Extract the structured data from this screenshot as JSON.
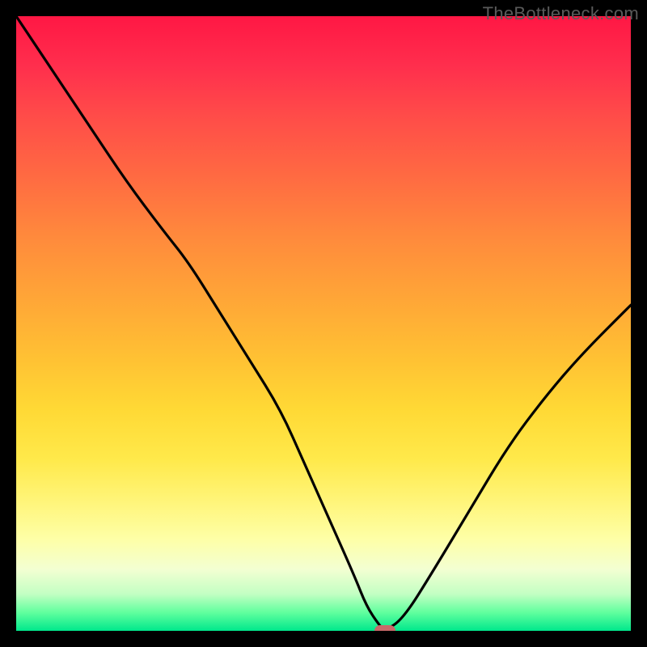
{
  "watermark": "TheBottleneck.com",
  "colors": {
    "page_bg": "#000000",
    "curve_stroke": "#000000",
    "marker_fill": "#c96a6a",
    "watermark_text": "#5a5a5a",
    "gradient_stops": [
      "#ff1744",
      "#ff2e4d",
      "#ff4b49",
      "#ff6a42",
      "#ff8a3c",
      "#ffa637",
      "#ffc233",
      "#ffd935",
      "#ffe94a",
      "#fff57a",
      "#feffa6",
      "#f3ffd2",
      "#c3ffc3",
      "#61ff9e",
      "#00e88c"
    ]
  },
  "chart_data": {
    "type": "line",
    "title": "",
    "xlabel": "",
    "ylabel": "",
    "xlim": [
      0,
      100
    ],
    "ylim": [
      0,
      100
    ],
    "grid": false,
    "legend": false,
    "background": "vertical rainbow gradient (green bottom → red top) indicating bottleneck severity",
    "series": [
      {
        "name": "bottleneck-curve",
        "x": [
          0,
          6,
          12,
          18,
          24,
          28,
          33,
          38,
          43,
          47,
          51,
          55,
          57,
          59,
          60,
          63,
          68,
          74,
          80,
          86,
          92,
          100
        ],
        "values": [
          100,
          91,
          82,
          73,
          65,
          60,
          52,
          44,
          36,
          27,
          18,
          9,
          4,
          1,
          0,
          2,
          10,
          20,
          30,
          38,
          45,
          53
        ]
      }
    ],
    "marker": {
      "name": "current-config-marker",
      "x": 60,
      "y": 0,
      "shape": "rounded-rect",
      "color": "#c96a6a"
    },
    "annotations": []
  }
}
